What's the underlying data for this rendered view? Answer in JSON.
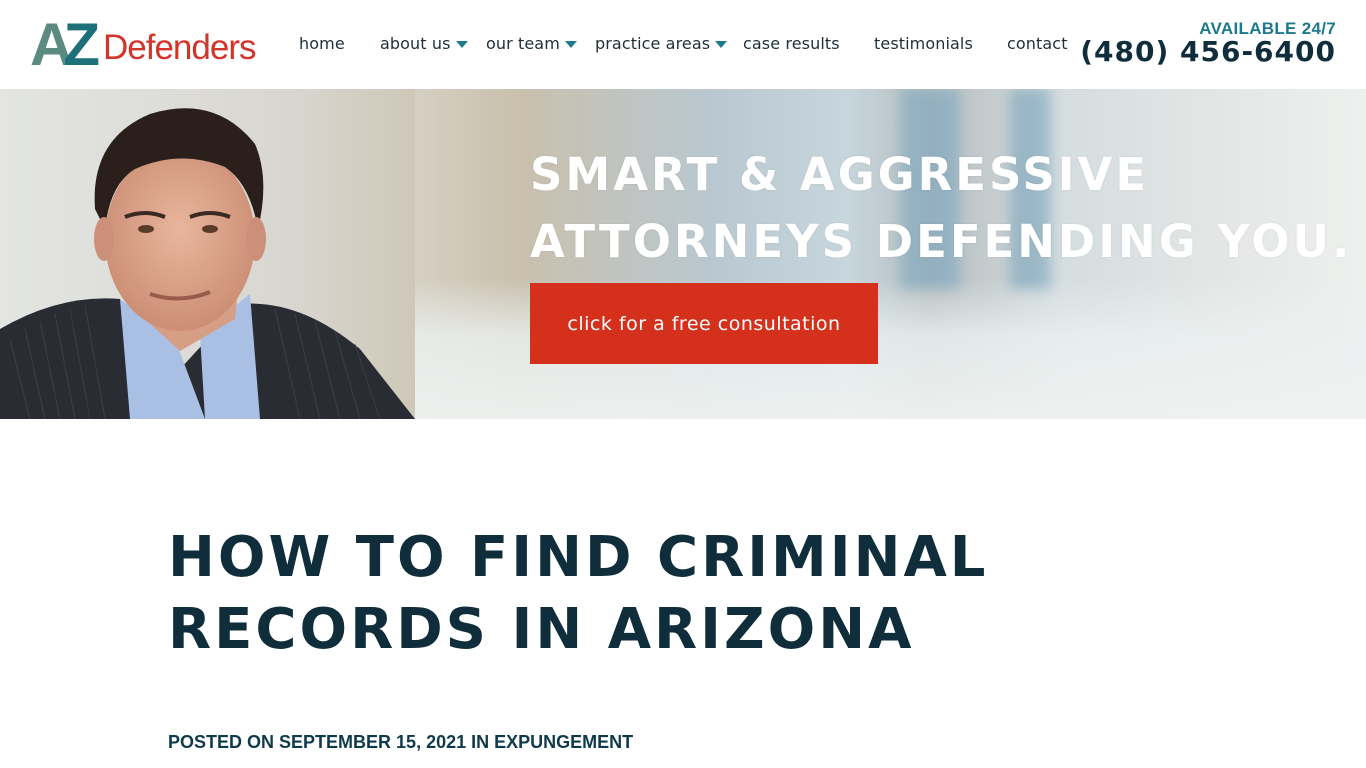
{
  "brand": {
    "logo_letters_a": "A",
    "logo_letters_z": "Z",
    "logo_text": "Defenders",
    "colors": {
      "teal": "#1d7a8c",
      "slate_green": "#5a8a80",
      "red": "#d2352b",
      "navy": "#0f2d3a",
      "cta_red": "#d4301b"
    }
  },
  "nav": {
    "items": [
      {
        "label": "home",
        "has_dropdown": false
      },
      {
        "label": "about us",
        "has_dropdown": true
      },
      {
        "label": "our team",
        "has_dropdown": true
      },
      {
        "label": "practice areas",
        "has_dropdown": true
      },
      {
        "label": "case results",
        "has_dropdown": false
      },
      {
        "label": "testimonials",
        "has_dropdown": false
      },
      {
        "label": "contact",
        "has_dropdown": false
      }
    ],
    "dropdown_icon": "caret-down-icon"
  },
  "contact": {
    "availability": "AVAILABLE 24/7",
    "phone": "(480) 456-6400"
  },
  "hero": {
    "headline_line1": "SMART & AGGRESSIVE",
    "headline_line2": "ATTORNEYS DEFENDING YOU.",
    "cta_label": "click for a free consultation",
    "portrait_alt": "attorney portrait"
  },
  "post": {
    "title": "HOW TO FIND CRIMINAL RECORDS IN ARIZONA",
    "posted_prefix": "POSTED ON",
    "date": "SEPTEMBER 15, 2021",
    "in_prefix": "IN",
    "category": "EXPUNGEMENT"
  }
}
